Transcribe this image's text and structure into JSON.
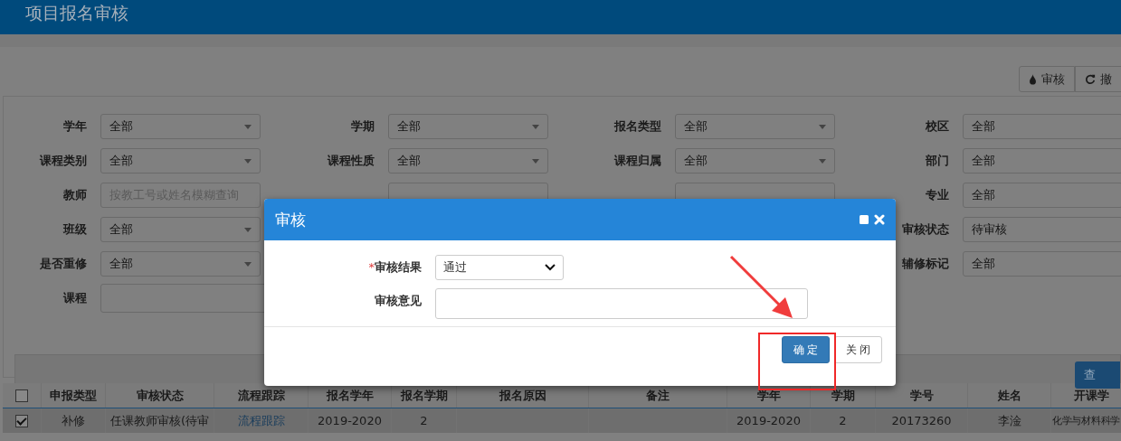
{
  "page": {
    "title": "项目报名审核"
  },
  "toolbar": [
    {
      "label": "审核"
    },
    {
      "label": "撤"
    }
  ],
  "filters": [
    [
      {
        "kind": "select",
        "label": "学年",
        "value": "全部"
      },
      {
        "kind": "select",
        "label": "学期",
        "value": "全部"
      },
      {
        "kind": "select",
        "label": "报名类型",
        "value": "全部"
      },
      {
        "kind": "plain",
        "label": "校区",
        "value": "全部"
      }
    ],
    [
      {
        "kind": "select",
        "label": "课程类别",
        "value": "全部"
      },
      {
        "kind": "select",
        "label": "课程性质",
        "value": "全部"
      },
      {
        "kind": "select",
        "label": "课程归属",
        "value": "全部"
      },
      {
        "kind": "plain",
        "label": "部门",
        "value": "全部"
      }
    ],
    [
      {
        "kind": "input",
        "label": "教师",
        "placeholder": "按教工号或姓名模糊查询"
      },
      {
        "kind": "blank"
      },
      {
        "kind": "blank"
      },
      {
        "kind": "plain",
        "label": "专业",
        "value": "全部"
      }
    ],
    [
      {
        "kind": "select",
        "label": "班级",
        "value": "全部"
      },
      {
        "kind": "none"
      },
      {
        "kind": "none"
      },
      {
        "kind": "plain",
        "label": "审核状态",
        "value": "待审核"
      }
    ],
    [
      {
        "kind": "select",
        "label": "是否重修",
        "value": "全部"
      },
      {
        "kind": "none"
      },
      {
        "kind": "none"
      },
      {
        "kind": "plain",
        "label": "辅修标记",
        "value": "全部"
      }
    ],
    [
      {
        "kind": "wide",
        "label": "课程"
      },
      {
        "kind": "none"
      },
      {
        "kind": "none"
      },
      {
        "kind": "none"
      }
    ]
  ],
  "search_button": {
    "label": "查"
  },
  "table": {
    "all_checked": false,
    "columns": [
      "申报类型",
      "审核状态",
      "流程跟踪",
      "报名学年",
      "报名学期",
      "报名原因",
      "备注",
      "学年",
      "学期",
      "学号",
      "姓名",
      "开课学"
    ],
    "rows": [
      {
        "selected": true,
        "cells": [
          {
            "text": "补修"
          },
          {
            "text": "任课教师审核(待审"
          },
          {
            "text": "流程跟踪",
            "kind": "link"
          },
          {
            "text": "2019-2020"
          },
          {
            "text": "2"
          },
          {
            "text": ""
          },
          {
            "text": ""
          },
          {
            "text": "2019-2020"
          },
          {
            "text": "2"
          },
          {
            "text": "20173260"
          },
          {
            "text": "李淦"
          },
          {
            "text": "化学与材料科学"
          }
        ]
      }
    ]
  },
  "dialog": {
    "title": "审核",
    "fields": [
      {
        "label": "审核结果",
        "required_mark": "*",
        "kind": "select",
        "value": "通过"
      },
      {
        "label": "审核意见",
        "kind": "textarea"
      }
    ],
    "buttons": [
      {
        "label": "确 定"
      },
      {
        "label": "关 闭"
      }
    ]
  }
}
